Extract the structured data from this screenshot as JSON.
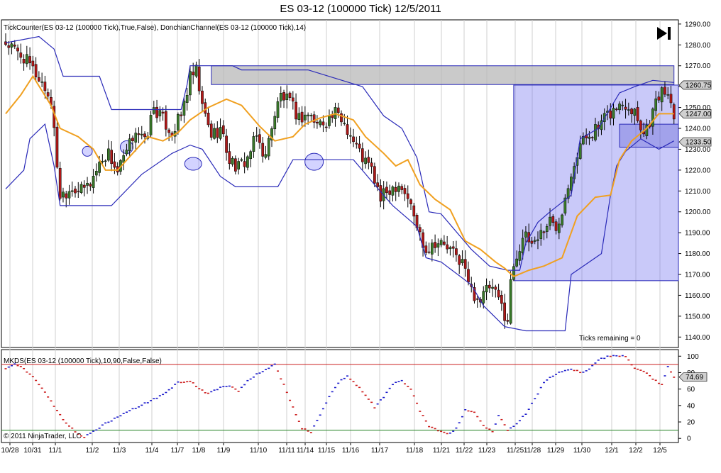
{
  "title": "ES 03-12 (100000 Tick)  12/5/2011",
  "top_panel": {
    "label": "TickCounter(ES 03-12 (100000 Tick),True,False), DonchianChannel(ES 03-12 (100000 Tick),14)",
    "ticks_remaining": "Ticks remaining = 0"
  },
  "bottom_panel": {
    "label": "MKDS(ES 03-12 (100000 Tick),10,90,False,False)",
    "copyright": "© 2011 NinjaTrader, LLC"
  },
  "colors": {
    "up": "#3a7a2a",
    "down": "#b01818",
    "donchian": "#2a2ab8",
    "orange_line": "#f0a020",
    "zone_box": "#7070f0",
    "grey_zone": "#b8b8b8",
    "overbought": "#cc2020",
    "oversold": "#208020"
  },
  "chart_data": [
    {
      "type": "candlestick",
      "title": "ES 03-12 (100000 Tick)  12/5/2011",
      "ylim": [
        1135,
        1292
      ],
      "yticks": [
        "1290.00",
        "1280.00",
        "1270.00",
        "1260.00",
        "1250.00",
        "1240.00",
        "1230.00",
        "1220.00",
        "1210.00",
        "1200.00",
        "1190.00",
        "1180.00",
        "1170.00",
        "1160.00",
        "1150.00",
        "1140.00"
      ],
      "xticks": [
        "10/28",
        "10/31",
        "11/1",
        "11/2",
        "11/3",
        "11/4",
        "11/7",
        "11/8",
        "11/9",
        "11/10",
        "11/11",
        "11/14",
        "11/15",
        "11/16",
        "11/17",
        "11/18",
        "11/21",
        "11/22",
        "11/23",
        "11/25",
        "11/28",
        "11/29",
        "11/30",
        "12/1",
        "12/2",
        "12/5"
      ],
      "price_tags": [
        "1260.75",
        "1247.00",
        "1233.50"
      ],
      "close_anchors": [
        [
          0,
          1281
        ],
        [
          4,
          1276
        ],
        [
          6,
          1274
        ],
        [
          10,
          1266
        ],
        [
          12,
          1262
        ],
        [
          15,
          1253
        ],
        [
          18,
          1208
        ],
        [
          22,
          1212
        ],
        [
          25,
          1210
        ],
        [
          28,
          1214
        ],
        [
          32,
          1226
        ],
        [
          34,
          1228
        ],
        [
          37,
          1219
        ],
        [
          40,
          1228
        ],
        [
          43,
          1240
        ],
        [
          46,
          1233
        ],
        [
          49,
          1250
        ],
        [
          52,
          1244
        ],
        [
          55,
          1238
        ],
        [
          58,
          1246
        ],
        [
          61,
          1264
        ],
        [
          63,
          1267
        ],
        [
          65,
          1250
        ],
        [
          68,
          1237
        ],
        [
          71,
          1240
        ],
        [
          74,
          1225
        ],
        [
          77,
          1221
        ],
        [
          80,
          1226
        ],
        [
          83,
          1236
        ],
        [
          86,
          1226
        ],
        [
          88,
          1242
        ],
        [
          91,
          1256
        ],
        [
          94,
          1252
        ],
        [
          97,
          1245
        ],
        [
          100,
          1247
        ],
        [
          103,
          1242
        ],
        [
          106,
          1244
        ],
        [
          109,
          1247
        ],
        [
          112,
          1243
        ],
        [
          115,
          1234
        ],
        [
          118,
          1226
        ],
        [
          121,
          1220
        ],
        [
          124,
          1206
        ],
        [
          127,
          1211
        ],
        [
          130,
          1214
        ],
        [
          133,
          1207
        ],
        [
          136,
          1193
        ],
        [
          139,
          1182
        ],
        [
          142,
          1186
        ],
        [
          145,
          1184
        ],
        [
          148,
          1180
        ],
        [
          151,
          1176
        ],
        [
          154,
          1162
        ],
        [
          157,
          1158
        ],
        [
          160,
          1164
        ],
        [
          163,
          1158
        ],
        [
          166,
          1148
        ],
        [
          167,
          1166
        ],
        [
          168,
          1175
        ],
        [
          171,
          1188
        ],
        [
          174,
          1185
        ],
        [
          177,
          1190
        ],
        [
          180,
          1196
        ],
        [
          182,
          1192
        ],
        [
          184,
          1202
        ],
        [
          187,
          1220
        ],
        [
          190,
          1232
        ],
        [
          193,
          1238
        ],
        [
          196,
          1240
        ],
        [
          199,
          1246
        ],
        [
          202,
          1250
        ],
        [
          205,
          1252
        ],
        [
          208,
          1249
        ],
        [
          211,
          1238
        ],
        [
          213,
          1244
        ],
        [
          216,
          1256
        ],
        [
          219,
          1258
        ],
        [
          221,
          1247
        ]
      ],
      "donchian_upper": [
        [
          0,
          1281
        ],
        [
          11,
          1284
        ],
        [
          16,
          1278
        ],
        [
          19,
          1265
        ],
        [
          26,
          1265
        ],
        [
          31,
          1265
        ],
        [
          35,
          1249
        ],
        [
          58,
          1249
        ],
        [
          60,
          1261
        ],
        [
          61,
          1270
        ],
        [
          75,
          1270
        ],
        [
          78,
          1268
        ],
        [
          100,
          1268
        ],
        [
          118,
          1260
        ],
        [
          125,
          1246
        ],
        [
          131,
          1240
        ],
        [
          136,
          1226
        ],
        [
          140,
          1200
        ],
        [
          144,
          1199
        ],
        [
          154,
          1182
        ],
        [
          160,
          1174
        ],
        [
          166,
          1172
        ],
        [
          170,
          1172
        ],
        [
          172,
          1185
        ],
        [
          176,
          1195
        ],
        [
          180,
          1200
        ],
        [
          187,
          1208
        ],
        [
          190,
          1235
        ],
        [
          196,
          1240
        ],
        [
          203,
          1257
        ],
        [
          208,
          1260
        ],
        [
          214,
          1263
        ],
        [
          221,
          1262
        ]
      ],
      "donchian_lower": [
        [
          0,
          1211
        ],
        [
          6,
          1220
        ],
        [
          8,
          1235
        ],
        [
          13,
          1242
        ],
        [
          16,
          1222
        ],
        [
          18,
          1203
        ],
        [
          30,
          1203
        ],
        [
          35,
          1203
        ],
        [
          45,
          1218
        ],
        [
          55,
          1228
        ],
        [
          61,
          1232
        ],
        [
          65,
          1230
        ],
        [
          71,
          1217
        ],
        [
          76,
          1212
        ],
        [
          90,
          1212
        ],
        [
          95,
          1225
        ],
        [
          115,
          1225
        ],
        [
          122,
          1213
        ],
        [
          128,
          1203
        ],
        [
          136,
          1193
        ],
        [
          139,
          1178
        ],
        [
          144,
          1176
        ],
        [
          154,
          1165
        ],
        [
          158,
          1155
        ],
        [
          165,
          1145
        ],
        [
          172,
          1143
        ],
        [
          185,
          1143
        ],
        [
          187,
          1170
        ],
        [
          197,
          1180
        ],
        [
          200,
          1208
        ],
        [
          202,
          1222
        ],
        [
          205,
          1229
        ],
        [
          210,
          1235
        ],
        [
          216,
          1230
        ],
        [
          221,
          1234
        ]
      ],
      "moving_average": [
        [
          0,
          1247
        ],
        [
          5,
          1256
        ],
        [
          9,
          1265
        ],
        [
          15,
          1251
        ],
        [
          18,
          1240
        ],
        [
          24,
          1236
        ],
        [
          29,
          1230
        ],
        [
          33,
          1220
        ],
        [
          37,
          1220
        ],
        [
          42,
          1228
        ],
        [
          47,
          1236
        ],
        [
          52,
          1234
        ],
        [
          57,
          1238
        ],
        [
          61,
          1244
        ],
        [
          67,
          1250
        ],
        [
          73,
          1254
        ],
        [
          78,
          1251
        ],
        [
          84,
          1241
        ],
        [
          89,
          1234
        ],
        [
          95,
          1236
        ],
        [
          99,
          1242
        ],
        [
          104,
          1245
        ],
        [
          109,
          1247
        ],
        [
          115,
          1244
        ],
        [
          119,
          1236
        ],
        [
          125,
          1228
        ],
        [
          129,
          1222
        ],
        [
          133,
          1225
        ],
        [
          137,
          1213
        ],
        [
          142,
          1206
        ],
        [
          147,
          1201
        ],
        [
          152,
          1186
        ],
        [
          157,
          1182
        ],
        [
          162,
          1176
        ],
        [
          165,
          1173
        ],
        [
          168,
          1169
        ],
        [
          173,
          1172
        ],
        [
          178,
          1174
        ],
        [
          184,
          1178
        ],
        [
          189,
          1198
        ],
        [
          195,
          1207
        ],
        [
          200,
          1208
        ],
        [
          203,
          1225
        ],
        [
          207,
          1234
        ],
        [
          212,
          1240
        ],
        [
          216,
          1247
        ],
        [
          221,
          1247
        ]
      ],
      "zone_box": {
        "x0": 168,
        "x1": 221,
        "y_top": 1260.75,
        "y_bottom": 1167
      },
      "grey_zone": {
        "x0": 68,
        "x1": 221,
        "y_top": 1270,
        "y_bottom": 1261
      },
      "inner_box": {
        "x0": 203,
        "x1": 221,
        "y_top": 1242,
        "y_bottom": 1231
      }
    },
    {
      "type": "scatter",
      "title": "MKDS(ES 03-12 (100000 Tick),10,90,False,False)",
      "ylim": [
        -5,
        108
      ],
      "yticks": [
        "100",
        "80",
        "60",
        "40",
        "20",
        "0"
      ],
      "last_value": "74.69",
      "overbought": 90,
      "oversold": 10,
      "anchors": [
        [
          0,
          85
        ],
        [
          3,
          90
        ],
        [
          6,
          85
        ],
        [
          9,
          75
        ],
        [
          12,
          62
        ],
        [
          15,
          45
        ],
        [
          18,
          28
        ],
        [
          21,
          15
        ],
        [
          24,
          5
        ],
        [
          26,
          2
        ],
        [
          29,
          8
        ],
        [
          33,
          18
        ],
        [
          37,
          26
        ],
        [
          41,
          34
        ],
        [
          44,
          39
        ],
        [
          47,
          44
        ],
        [
          50,
          49
        ],
        [
          53,
          56
        ],
        [
          57,
          68
        ],
        [
          61,
          70
        ],
        [
          64,
          60
        ],
        [
          67,
          54
        ],
        [
          71,
          62
        ],
        [
          74,
          64
        ],
        [
          77,
          58
        ],
        [
          80,
          70
        ],
        [
          83,
          78
        ],
        [
          86,
          84
        ],
        [
          89,
          90
        ],
        [
          92,
          65
        ],
        [
          95,
          38
        ],
        [
          98,
          12
        ],
        [
          101,
          8
        ],
        [
          104,
          28
        ],
        [
          107,
          50
        ],
        [
          110,
          68
        ],
        [
          113,
          75
        ],
        [
          116,
          65
        ],
        [
          119,
          53
        ],
        [
          122,
          38
        ],
        [
          125,
          50
        ],
        [
          128,
          66
        ],
        [
          131,
          70
        ],
        [
          134,
          60
        ],
        [
          137,
          33
        ],
        [
          140,
          15
        ],
        [
          143,
          10
        ],
        [
          146,
          5
        ],
        [
          149,
          12
        ],
        [
          152,
          35
        ],
        [
          155,
          32
        ],
        [
          158,
          15
        ],
        [
          161,
          8
        ],
        [
          163,
          28
        ],
        [
          166,
          10
        ],
        [
          169,
          18
        ],
        [
          172,
          30
        ],
        [
          175,
          48
        ],
        [
          178,
          68
        ],
        [
          181,
          76
        ],
        [
          184,
          82
        ],
        [
          187,
          85
        ],
        [
          190,
          80
        ],
        [
          193,
          84
        ],
        [
          196,
          95
        ],
        [
          199,
          100
        ],
        [
          202,
          100
        ],
        [
          205,
          100
        ],
        [
          208,
          85
        ],
        [
          211,
          82
        ],
        [
          214,
          72
        ],
        [
          217,
          65
        ],
        [
          219,
          88
        ],
        [
          221,
          75
        ]
      ]
    }
  ]
}
